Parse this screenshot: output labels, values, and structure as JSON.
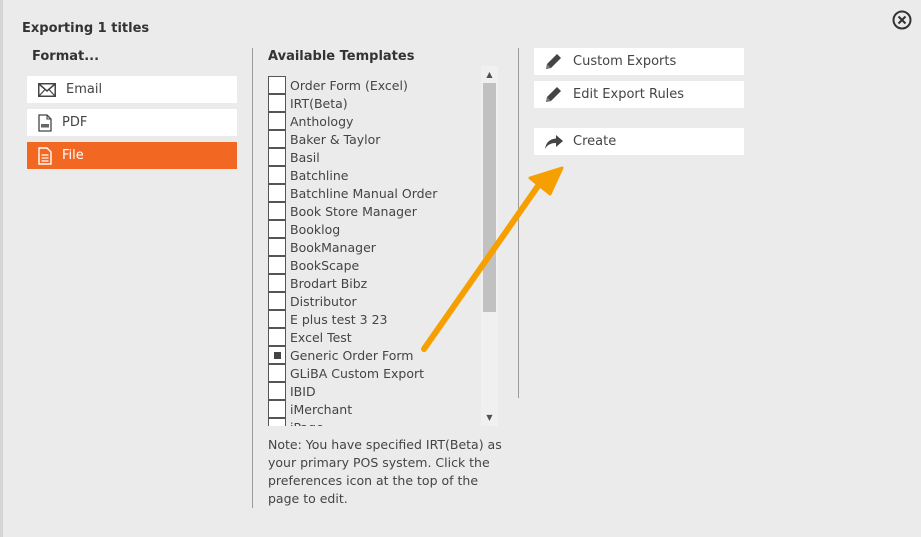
{
  "dialog": {
    "title": "Exporting 1 titles"
  },
  "format": {
    "heading": "Format...",
    "options": [
      {
        "label": "Email",
        "icon": "envelope-icon"
      },
      {
        "label": "PDF",
        "icon": "pdf-file-icon"
      },
      {
        "label": "File",
        "icon": "document-icon",
        "selected": true
      }
    ],
    "accent_color": "#f26722"
  },
  "templates": {
    "heading": "Available Templates",
    "items": [
      {
        "label": "Order Form (Excel)",
        "checked": false
      },
      {
        "label": "IRT(Beta)",
        "checked": false
      },
      {
        "label": "Anthology",
        "checked": false
      },
      {
        "label": "Baker & Taylor",
        "checked": false
      },
      {
        "label": "Basil",
        "checked": false
      },
      {
        "label": "Batchline",
        "checked": false
      },
      {
        "label": "Batchline Manual Order",
        "checked": false
      },
      {
        "label": "Book Store Manager",
        "checked": false
      },
      {
        "label": "Booklog",
        "checked": false
      },
      {
        "label": "BookManager",
        "checked": false
      },
      {
        "label": "BookScape",
        "checked": false
      },
      {
        "label": "Brodart Bibz",
        "checked": false
      },
      {
        "label": "Distributor",
        "checked": false
      },
      {
        "label": "E plus test 3 23",
        "checked": false
      },
      {
        "label": "Excel Test",
        "checked": false
      },
      {
        "label": "Generic Order Form",
        "checked": true
      },
      {
        "label": "GLiBA Custom Export",
        "checked": false
      },
      {
        "label": "IBID",
        "checked": false
      },
      {
        "label": "iMerchant",
        "checked": false
      },
      {
        "label": "iPage",
        "checked": false
      }
    ],
    "note": "Note: You have specified IRT(Beta) as your primary POS system. Click the preferences icon at the top of the page to edit."
  },
  "actions": {
    "custom_exports": "Custom Exports",
    "edit_export_rules": "Edit Export Rules",
    "create": "Create"
  },
  "annotation": {
    "arrow_color": "#f5a000"
  }
}
